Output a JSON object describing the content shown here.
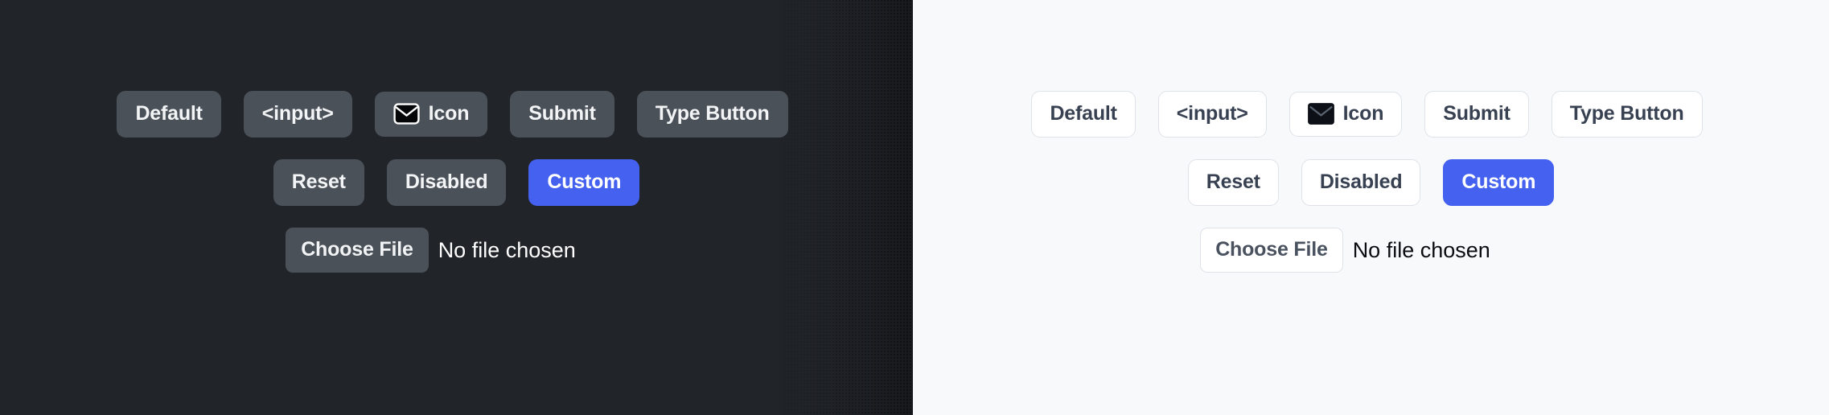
{
  "panels": [
    {
      "theme": "dark",
      "background": "#212429",
      "rows": [
        {
          "buttons": [
            {
              "label": "Default",
              "variant": "default",
              "icon": null
            },
            {
              "label": "<input>",
              "variant": "default",
              "icon": null
            },
            {
              "label": "Icon",
              "variant": "icon",
              "icon": "envelope-icon"
            },
            {
              "label": "Submit",
              "variant": "default",
              "icon": null
            },
            {
              "label": "Type Button",
              "variant": "default",
              "icon": null
            }
          ]
        },
        {
          "buttons": [
            {
              "label": "Reset",
              "variant": "default",
              "icon": null
            },
            {
              "label": "Disabled",
              "variant": "disabled",
              "icon": null
            },
            {
              "label": "Custom",
              "variant": "accent",
              "icon": null
            }
          ]
        }
      ],
      "file_input": {
        "button_label": "Choose File",
        "status_text": "No file chosen"
      }
    },
    {
      "theme": "light",
      "background": "#f8f9fb",
      "rows": [
        {
          "buttons": [
            {
              "label": "Default",
              "variant": "default",
              "icon": null
            },
            {
              "label": "<input>",
              "variant": "default",
              "icon": null
            },
            {
              "label": "Icon",
              "variant": "icon",
              "icon": "envelope-icon"
            },
            {
              "label": "Submit",
              "variant": "default",
              "icon": null
            },
            {
              "label": "Type Button",
              "variant": "default",
              "icon": null
            }
          ]
        },
        {
          "buttons": [
            {
              "label": "Reset",
              "variant": "default",
              "icon": null
            },
            {
              "label": "Disabled",
              "variant": "disabled",
              "icon": null
            },
            {
              "label": "Custom",
              "variant": "accent",
              "icon": null
            }
          ]
        }
      ],
      "file_input": {
        "button_label": "Choose File",
        "status_text": "No file chosen"
      }
    }
  ],
  "colors": {
    "dark_background": "#212429",
    "dark_button_face": "#4b5158",
    "dark_button_text": "#f3f4f6",
    "light_background": "#f8f9fb",
    "light_button_face": "#ffffff",
    "light_button_border": "#dfe2e8",
    "light_button_text": "#384152",
    "accent": "#4561f0",
    "accent_text": "#ffffff"
  }
}
